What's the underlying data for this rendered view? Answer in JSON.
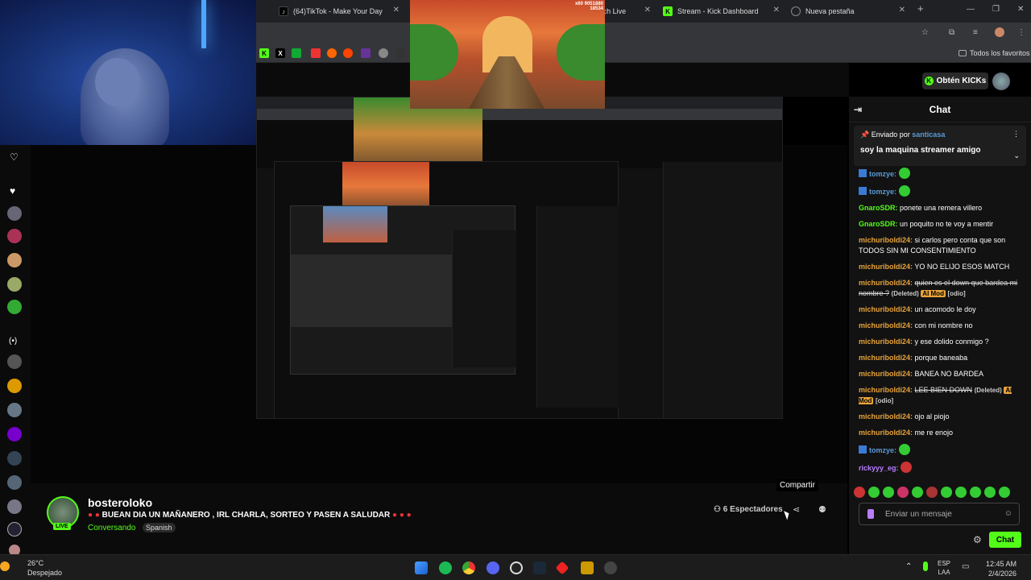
{
  "browser": {
    "tabs": [
      {
        "label": "(64)TikTok - Make Your Day",
        "icon": "tiktok-icon"
      },
      {
        "label": "Watch Live",
        "icon": "kick-icon"
      },
      {
        "label": "Stream - Kick Dashboard",
        "icon": "kick-icon"
      },
      {
        "label": "Nueva pestaña",
        "icon": "globe-icon"
      }
    ],
    "bookmarks_label": "Todos los favoritos"
  },
  "game_overlay": {
    "score_top": "x60  9051880",
    "score_bottom": "18534"
  },
  "header": {
    "kicks_button": "Obtén KICKs"
  },
  "chat": {
    "title": "Chat",
    "pinned": {
      "sent_by_label": "Enviado por",
      "sender": "santicasa",
      "text": "soy la maquina streamer amigo"
    },
    "messages": [
      {
        "user": "tomzye:",
        "text": "",
        "style": "blue"
      },
      {
        "user": "tomzye:",
        "text": "",
        "style": "blue"
      },
      {
        "user": "GnaroSDR:",
        "text": "ponete una remera villero",
        "style": "green"
      },
      {
        "user": "GnaroSDR:",
        "text": "un poquito no te voy a mentir",
        "style": "green"
      },
      {
        "user": "michuriboldi24:",
        "text": "si carlos pero conta que son TODOS SIN MI CONSENTIMIENTO",
        "style": "orange"
      },
      {
        "user": "michuriboldi24:",
        "text": "YO NO ELIJO ESOS MATCH",
        "style": "orange"
      },
      {
        "user": "michuriboldi24:",
        "text": "quien es el down que bardea mi nombre ?",
        "deleted": true,
        "style": "orange"
      },
      {
        "user": "michuriboldi24:",
        "text": "un acomodo le doy",
        "style": "orange"
      },
      {
        "user": "michuriboldi24:",
        "text": "con mi nombre no",
        "style": "orange"
      },
      {
        "user": "michuriboldi24:",
        "text": "y ese dolido conmigo ?",
        "style": "orange"
      },
      {
        "user": "michuriboldi24:",
        "text": "porque baneaba",
        "style": "orange"
      },
      {
        "user": "michuriboldi24:",
        "text": "BANEA NO BARDEA",
        "style": "orange"
      },
      {
        "user": "michuriboldi24:",
        "text": "LEE BIEN DOWN",
        "deleted": true,
        "style": "orange"
      },
      {
        "user": "michuriboldi24:",
        "text": "ojo al piojo",
        "style": "orange"
      },
      {
        "user": "michuriboldi24:",
        "text": "me re enojo",
        "style": "orange"
      },
      {
        "user": "tomzye:",
        "text": "",
        "style": "blue"
      },
      {
        "user": "rickyyy_eg:",
        "text": "",
        "style": "purple"
      }
    ],
    "deleted_label": "(Deleted)",
    "mod_label": "AI Mod",
    "odio_label": "[odio]",
    "input_placeholder": "Enviar un mensaje",
    "send_label": "Chat"
  },
  "streamer": {
    "name": "bosteroloko",
    "title": "BUEAN DIA UN MAÑANERO , IRL CHARLA, SORTEO Y PASEN A SALUDAR",
    "category": "Conversando",
    "language": "Spanish",
    "live_label": "LIVE",
    "viewers": "6 Espectadores",
    "share_tooltip": "Compartir"
  },
  "taskbar": {
    "temp": "26°C",
    "weather": "Despejado",
    "lang_top": "ESP",
    "lang_bottom": "LAA",
    "time": "12:45 AM",
    "date": "2/4/2026"
  },
  "colors": {
    "accent": "#53fc18",
    "mod": "#e8a33a",
    "user_blue": "#5b9bd5"
  }
}
